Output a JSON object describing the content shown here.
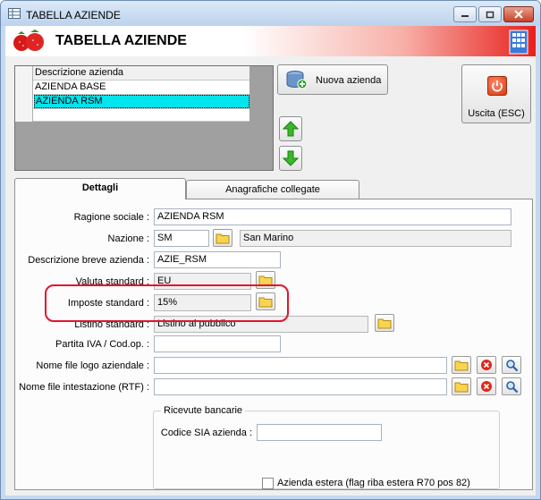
{
  "window": {
    "title": "TABELLA AZIENDE"
  },
  "header": {
    "title": "TABELLA AZIENDE"
  },
  "grid": {
    "column_header": "Descrizione azienda",
    "rows": [
      "AZIENDA BASE",
      "AZIENDA RSM"
    ],
    "selected_index": 1
  },
  "buttons": {
    "new_company": "Nuova azienda",
    "exit": "Uscita (ESC)"
  },
  "tabs": {
    "details": "Dettagli",
    "linked_records": "Anagrafiche collegate"
  },
  "form": {
    "ragione_sociale": {
      "label": "Ragione sociale :",
      "value": "AZIENDA RSM"
    },
    "nazione": {
      "label": "Nazione :",
      "code": "SM",
      "name": "San Marino"
    },
    "descrizione_breve": {
      "label": "Descrizione breve azienda :",
      "value": "AZIE_RSM"
    },
    "valuta": {
      "label": "Valuta standard :",
      "value": "EU"
    },
    "imposte": {
      "label": "Imposte standard :",
      "value": "15%"
    },
    "listino": {
      "label": "Listino standard :",
      "value": "Listino al pubblico"
    },
    "partita_iva": {
      "label": "Partita IVA / Cod.op. :",
      "value": ""
    },
    "logo_file": {
      "label": "Nome file logo aziendale :",
      "value": ""
    },
    "intestazione_file": {
      "label": "Nome file intestazione (RTF) :",
      "value": ""
    }
  },
  "ricevute": {
    "group_title": "Ricevute bancarie",
    "sia_label": "Codice SIA azienda :",
    "sia_value": "",
    "foreign_label": "Azienda estera (flag riba estera R70 pos 82)",
    "foreign_checked": false
  },
  "colors": {
    "selection": "#00e5ee",
    "highlight": "#e0162b",
    "banner_red": "#e8201c"
  }
}
